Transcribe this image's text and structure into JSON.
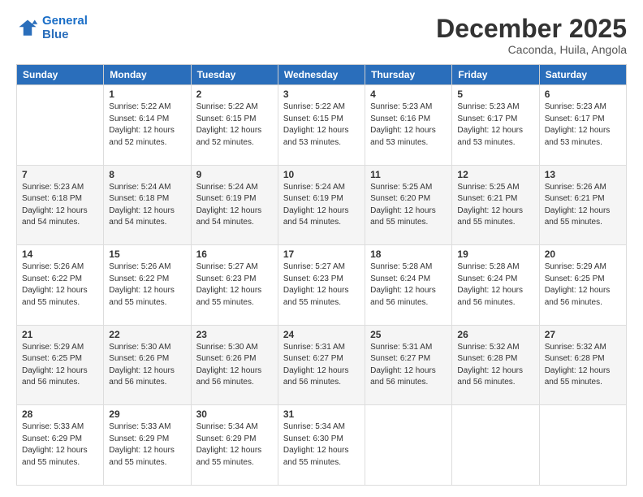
{
  "logo": {
    "line1": "General",
    "line2": "Blue"
  },
  "header": {
    "month": "December 2025",
    "location": "Caconda, Huila, Angola"
  },
  "weekdays": [
    "Sunday",
    "Monday",
    "Tuesday",
    "Wednesday",
    "Thursday",
    "Friday",
    "Saturday"
  ],
  "weeks": [
    [
      {
        "day": "",
        "info": ""
      },
      {
        "day": "1",
        "info": "Sunrise: 5:22 AM\nSunset: 6:14 PM\nDaylight: 12 hours\nand 52 minutes."
      },
      {
        "day": "2",
        "info": "Sunrise: 5:22 AM\nSunset: 6:15 PM\nDaylight: 12 hours\nand 52 minutes."
      },
      {
        "day": "3",
        "info": "Sunrise: 5:22 AM\nSunset: 6:15 PM\nDaylight: 12 hours\nand 53 minutes."
      },
      {
        "day": "4",
        "info": "Sunrise: 5:23 AM\nSunset: 6:16 PM\nDaylight: 12 hours\nand 53 minutes."
      },
      {
        "day": "5",
        "info": "Sunrise: 5:23 AM\nSunset: 6:17 PM\nDaylight: 12 hours\nand 53 minutes."
      },
      {
        "day": "6",
        "info": "Sunrise: 5:23 AM\nSunset: 6:17 PM\nDaylight: 12 hours\nand 53 minutes."
      }
    ],
    [
      {
        "day": "7",
        "info": "Sunrise: 5:23 AM\nSunset: 6:18 PM\nDaylight: 12 hours\nand 54 minutes."
      },
      {
        "day": "8",
        "info": "Sunrise: 5:24 AM\nSunset: 6:18 PM\nDaylight: 12 hours\nand 54 minutes."
      },
      {
        "day": "9",
        "info": "Sunrise: 5:24 AM\nSunset: 6:19 PM\nDaylight: 12 hours\nand 54 minutes."
      },
      {
        "day": "10",
        "info": "Sunrise: 5:24 AM\nSunset: 6:19 PM\nDaylight: 12 hours\nand 54 minutes."
      },
      {
        "day": "11",
        "info": "Sunrise: 5:25 AM\nSunset: 6:20 PM\nDaylight: 12 hours\nand 55 minutes."
      },
      {
        "day": "12",
        "info": "Sunrise: 5:25 AM\nSunset: 6:21 PM\nDaylight: 12 hours\nand 55 minutes."
      },
      {
        "day": "13",
        "info": "Sunrise: 5:26 AM\nSunset: 6:21 PM\nDaylight: 12 hours\nand 55 minutes."
      }
    ],
    [
      {
        "day": "14",
        "info": "Sunrise: 5:26 AM\nSunset: 6:22 PM\nDaylight: 12 hours\nand 55 minutes."
      },
      {
        "day": "15",
        "info": "Sunrise: 5:26 AM\nSunset: 6:22 PM\nDaylight: 12 hours\nand 55 minutes."
      },
      {
        "day": "16",
        "info": "Sunrise: 5:27 AM\nSunset: 6:23 PM\nDaylight: 12 hours\nand 55 minutes."
      },
      {
        "day": "17",
        "info": "Sunrise: 5:27 AM\nSunset: 6:23 PM\nDaylight: 12 hours\nand 55 minutes."
      },
      {
        "day": "18",
        "info": "Sunrise: 5:28 AM\nSunset: 6:24 PM\nDaylight: 12 hours\nand 56 minutes."
      },
      {
        "day": "19",
        "info": "Sunrise: 5:28 AM\nSunset: 6:24 PM\nDaylight: 12 hours\nand 56 minutes."
      },
      {
        "day": "20",
        "info": "Sunrise: 5:29 AM\nSunset: 6:25 PM\nDaylight: 12 hours\nand 56 minutes."
      }
    ],
    [
      {
        "day": "21",
        "info": "Sunrise: 5:29 AM\nSunset: 6:25 PM\nDaylight: 12 hours\nand 56 minutes."
      },
      {
        "day": "22",
        "info": "Sunrise: 5:30 AM\nSunset: 6:26 PM\nDaylight: 12 hours\nand 56 minutes."
      },
      {
        "day": "23",
        "info": "Sunrise: 5:30 AM\nSunset: 6:26 PM\nDaylight: 12 hours\nand 56 minutes."
      },
      {
        "day": "24",
        "info": "Sunrise: 5:31 AM\nSunset: 6:27 PM\nDaylight: 12 hours\nand 56 minutes."
      },
      {
        "day": "25",
        "info": "Sunrise: 5:31 AM\nSunset: 6:27 PM\nDaylight: 12 hours\nand 56 minutes."
      },
      {
        "day": "26",
        "info": "Sunrise: 5:32 AM\nSunset: 6:28 PM\nDaylight: 12 hours\nand 56 minutes."
      },
      {
        "day": "27",
        "info": "Sunrise: 5:32 AM\nSunset: 6:28 PM\nDaylight: 12 hours\nand 55 minutes."
      }
    ],
    [
      {
        "day": "28",
        "info": "Sunrise: 5:33 AM\nSunset: 6:29 PM\nDaylight: 12 hours\nand 55 minutes."
      },
      {
        "day": "29",
        "info": "Sunrise: 5:33 AM\nSunset: 6:29 PM\nDaylight: 12 hours\nand 55 minutes."
      },
      {
        "day": "30",
        "info": "Sunrise: 5:34 AM\nSunset: 6:29 PM\nDaylight: 12 hours\nand 55 minutes."
      },
      {
        "day": "31",
        "info": "Sunrise: 5:34 AM\nSunset: 6:30 PM\nDaylight: 12 hours\nand 55 minutes."
      },
      {
        "day": "",
        "info": ""
      },
      {
        "day": "",
        "info": ""
      },
      {
        "day": "",
        "info": ""
      }
    ]
  ]
}
